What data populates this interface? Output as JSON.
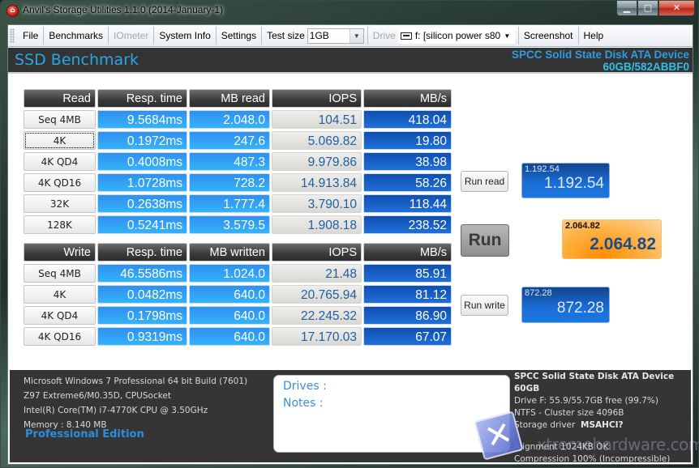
{
  "window": {
    "title": "Anvil's Storage Utilities 1.1.0 (2014-January-1)",
    "controls": {
      "minimize": "▁",
      "maximize": "▢",
      "close": "✕"
    }
  },
  "menubar": {
    "items": [
      "File",
      "Benchmarks",
      "IOmeter",
      "System Info",
      "Settings"
    ],
    "test_size_label": "Test size",
    "test_size_value": "1GB",
    "drive_label": "Drive",
    "drive_value": "f: [silicon power s80]",
    "screenshot": "Screenshot",
    "help": "Help"
  },
  "header": {
    "title": "SSD Benchmark",
    "device_line1": "SPCC Solid State Disk ATA Device",
    "device_line2": "60GB/582ABBF0"
  },
  "read_table": {
    "headers": [
      "Read",
      "Resp. time",
      "MB read",
      "IOPS",
      "MB/s"
    ],
    "rows": [
      {
        "label": "Seq 4MB",
        "resp": "9.5684ms",
        "mb": "2.048.0",
        "iops": "104.51",
        "mbs": "418.04"
      },
      {
        "label": "4K",
        "resp": "0.1972ms",
        "mb": "247.6",
        "iops": "5.069.82",
        "mbs": "19.80"
      },
      {
        "label": "4K QD4",
        "resp": "0.4008ms",
        "mb": "487.3",
        "iops": "9.979.86",
        "mbs": "38.98"
      },
      {
        "label": "4K QD16",
        "resp": "1.0728ms",
        "mb": "728.2",
        "iops": "14.913.84",
        "mbs": "58.26"
      },
      {
        "label": "32K",
        "resp": "0.2638ms",
        "mb": "1.777.4",
        "iops": "3.790.10",
        "mbs": "118.44"
      },
      {
        "label": "128K",
        "resp": "0.5241ms",
        "mb": "3.579.5",
        "iops": "1.908.18",
        "mbs": "238.52"
      }
    ]
  },
  "write_table": {
    "headers": [
      "Write",
      "Resp. time",
      "MB written",
      "IOPS",
      "MB/s"
    ],
    "rows": [
      {
        "label": "Seq 4MB",
        "resp": "46.5586ms",
        "mb": "1.024.0",
        "iops": "21.48",
        "mbs": "85.91"
      },
      {
        "label": "4K",
        "resp": "0.0482ms",
        "mb": "640.0",
        "iops": "20.765.94",
        "mbs": "81.12"
      },
      {
        "label": "4K QD4",
        "resp": "0.1798ms",
        "mb": "640.0",
        "iops": "22.245.32",
        "mbs": "86.90"
      },
      {
        "label": "4K QD16",
        "resp": "0.9319ms",
        "mb": "640.0",
        "iops": "17.170.03",
        "mbs": "67.07"
      }
    ]
  },
  "scores": {
    "run_read_label": "Run read",
    "run_label": "Run",
    "run_write_label": "Run write",
    "read_small": "1.192.54",
    "read_big": "1.192.54",
    "total_small": "2.064.82",
    "total_big": "2.064.82",
    "write_small": "872.28",
    "write_big": "872.28"
  },
  "footer": {
    "sysinfo": [
      "Microsoft Windows 7 Professional  64 bit Build (7601)",
      "Z97 Extreme6/M0.35D, CPUSocket",
      "Intel(R) Core(TM) i7-4770K CPU @ 3.50GHz",
      "Memory : 8.140 MB"
    ],
    "edition": "Professional Edition",
    "drives_label": "Drives :",
    "notes_label": "Notes :",
    "drive_title": "SPCC Solid State Disk ATA Device 60GB",
    "drive_free": "Drive F: 55.9/55.7GB free (99.7%)",
    "ntfs": "NTFS - Cluster size 4096B",
    "storage_driver_label": "Storage driver",
    "storage_driver_value": "MSAHCI?",
    "alignment": "Alignment 1024KB OK",
    "compression": "Compression 100% (Incompressible)",
    "watermark": "xtremehardware.com"
  },
  "colors": {
    "accent_blue": "#29a6e6",
    "header_bg": "#333333",
    "resp_cell": "#35b3f9",
    "mbs_cell": "#1f6fd8",
    "iops_text": "#1d5fa6",
    "total_score": "#ffb347"
  }
}
